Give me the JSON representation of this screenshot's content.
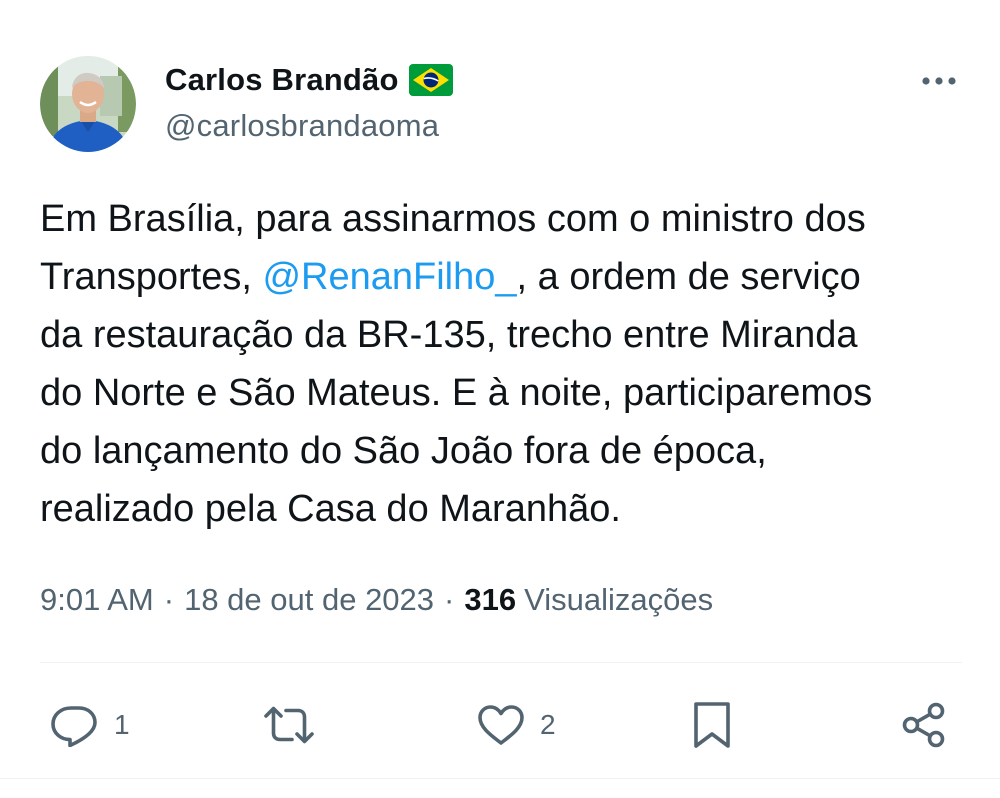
{
  "author": {
    "display_name": "Carlos Brandão",
    "handle": "@carlosbrandaoma",
    "badge_icon": "brazil-flag-icon"
  },
  "tweet": {
    "lines": [
      [
        "Em Brasília, para assinarmos com o ministro dos"
      ],
      [
        "Transportes, ",
        "@RenanFilho_",
        ", a ordem de serviço"
      ],
      [
        "da restauração da BR-135, trecho entre Miranda"
      ],
      [
        "do Norte e São Mateus. E à noite, participaremos"
      ],
      [
        "do lançamento do São João fora de época,"
      ],
      [
        "realizado pela Casa do Maranhão."
      ]
    ],
    "time": "9:01 AM",
    "separator": "·",
    "date": "18 de out de 2023",
    "views_count": "316",
    "views_label": "Visualizações"
  },
  "actions": {
    "reply": {
      "icon": "reply-icon",
      "count": "1"
    },
    "retweet": {
      "icon": "retweet-icon",
      "count": ""
    },
    "like": {
      "icon": "heart-icon",
      "count": "2"
    },
    "bookmark": {
      "icon": "bookmark-icon"
    },
    "share": {
      "icon": "share-icon"
    }
  },
  "colors": {
    "text": "#0f1419",
    "secondary": "#536471",
    "link": "#1d9bf0",
    "divider": "#eff3f4",
    "icon": "#536471"
  }
}
